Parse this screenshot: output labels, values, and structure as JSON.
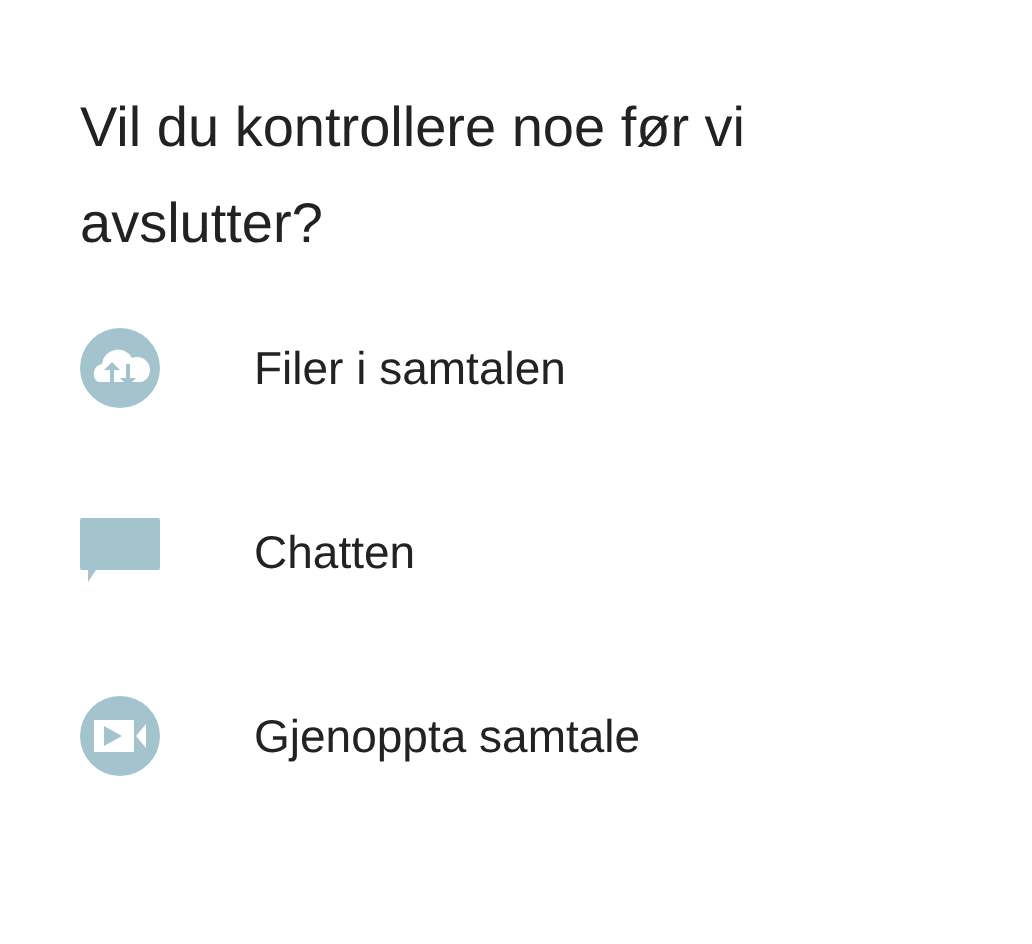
{
  "title": "Vil du kontrollere noe før vi avslutter?",
  "items": [
    {
      "kind": "files",
      "label": "Filer i samtalen"
    },
    {
      "kind": "chat",
      "label": "Chatten"
    },
    {
      "kind": "video",
      "label": "Gjenoppta samtale"
    }
  ]
}
